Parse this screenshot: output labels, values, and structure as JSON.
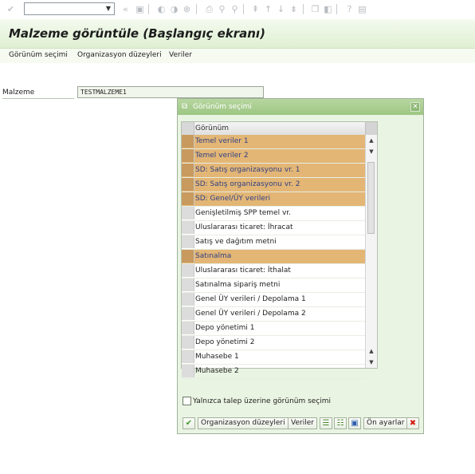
{
  "toolbar": {
    "icons": [
      "enter-icon",
      "dropdown-icon",
      "back-nav-icon",
      "save-icon",
      "back-icon",
      "exit-icon",
      "cancel-icon",
      "print-icon",
      "find-icon",
      "find-next-icon",
      "first-page-icon",
      "prev-page-icon",
      "next-page-icon",
      "last-page-icon",
      "new-session-icon",
      "shortcut-icon",
      "help-icon",
      "settings-icon"
    ]
  },
  "title": "Malzeme görüntüle (Başlangıç ekranı)",
  "menu": {
    "items": [
      "Görünüm seçimi",
      "Organizasyon düzeyleri",
      "Veriler"
    ]
  },
  "material": {
    "label": "Malzeme",
    "value": "TESTMALZEME1"
  },
  "dialog": {
    "title": "Görünüm seçimi",
    "column_header": "Görünüm",
    "rows": [
      {
        "label": "Temel veriler 1",
        "selected": true
      },
      {
        "label": "Temel veriler 2",
        "selected": true
      },
      {
        "label": "SD: Satış organizasyonu vr. 1",
        "selected": true
      },
      {
        "label": "SD: Satış organizasyonu vr. 2",
        "selected": true
      },
      {
        "label": "SD: Genel/ÜY verileri",
        "selected": true
      },
      {
        "label": "Genişletilmiş SPP temel vr.",
        "selected": false
      },
      {
        "label": "Uluslararası ticaret: İhracat",
        "selected": false
      },
      {
        "label": "Satış ve dağıtım metni",
        "selected": false
      },
      {
        "label": "Satınalma",
        "selected": true
      },
      {
        "label": "Uluslararası ticaret: İthalat",
        "selected": false
      },
      {
        "label": "Satınalma sipariş metni",
        "selected": false
      },
      {
        "label": "Genel ÜY verileri / Depolama 1",
        "selected": false
      },
      {
        "label": "Genel ÜY verileri / Depolama 2",
        "selected": false
      },
      {
        "label": "Depo yönetimi 1",
        "selected": false
      },
      {
        "label": "Depo yönetimi 2",
        "selected": false
      },
      {
        "label": "Muhasebe 1",
        "selected": false
      },
      {
        "label": "Muhasebe 2",
        "selected": false
      }
    ],
    "checkbox_label": "Yalnızca talep üzerine görünüm seçimi",
    "buttons": {
      "org_levels": "Organizasyon düzeyleri",
      "data": "Veriler",
      "defaults": "Ön ayarlar"
    },
    "colors": {
      "selected": "#e3b675",
      "selected_text": "#2e3f86",
      "title_bar": "#9dc683"
    }
  }
}
